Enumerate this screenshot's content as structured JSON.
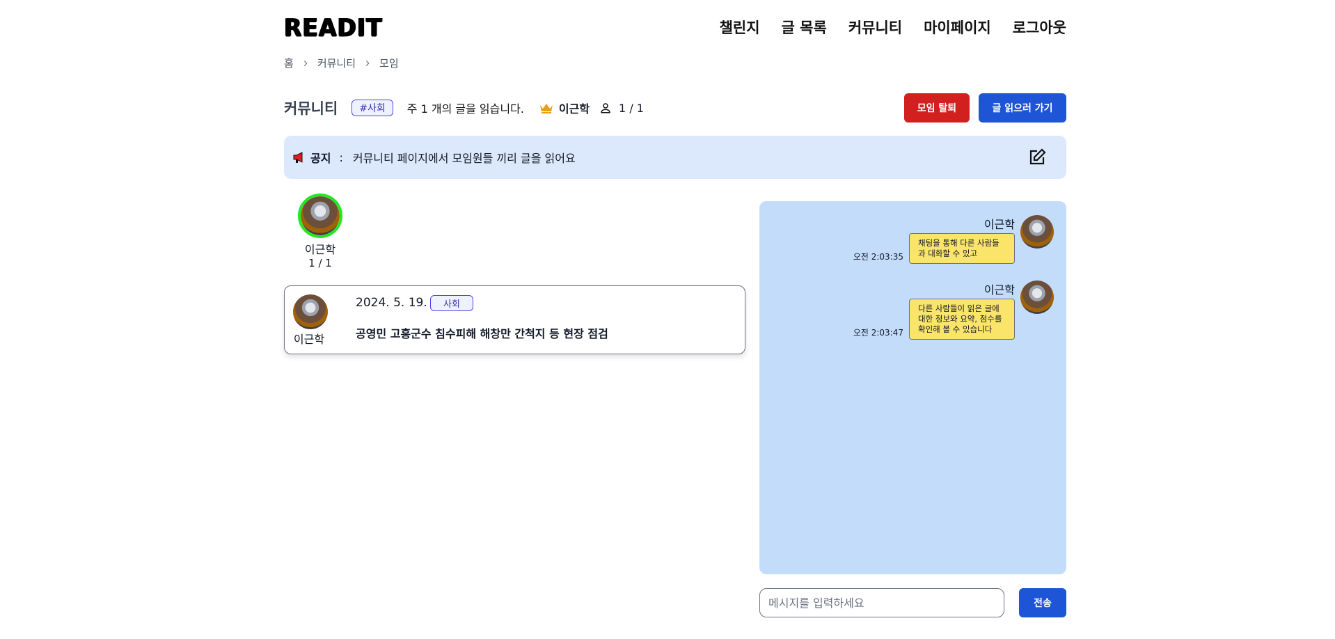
{
  "header": {
    "logo": "READIT",
    "nav": [
      "챌린지",
      "글 목록",
      "커뮤니티",
      "마이페이지",
      "로그아웃"
    ]
  },
  "breadcrumb": [
    "홈",
    "커뮤니티",
    "모임"
  ],
  "community": {
    "title": "커뮤니티",
    "tag": "#사회",
    "weekly_goal": "주 1 개의 글을 읽습니다.",
    "leader_name": "이근학",
    "member_count": "1 / 1",
    "leave_button": "모임 탈퇴",
    "read_button": "글 읽으러 가기"
  },
  "notice": {
    "label": "공지",
    "colon": ":",
    "text": "커뮤니티 페이지에서 모임원들 끼리 글을 읽어요"
  },
  "members": [
    {
      "name": "이근학",
      "progress": "1 / 1"
    }
  ],
  "posts": [
    {
      "author": "이근학",
      "date": "2024. 5. 19.",
      "category": "사회",
      "title": "공영민 고흥군수 침수피해 해창만 간척지 등 현장 점검"
    }
  ],
  "chat": {
    "messages": [
      {
        "name": "이근학",
        "time": "오전 2:03:35",
        "text": "채팅을 통해 다른 사람들과 대화할 수 있고"
      },
      {
        "name": "이근학",
        "time": "오전 2:03:47",
        "text": "다른 사람들이 읽은 글에 대한 정보와 요약, 점수를 확인해 볼 수 있습니다"
      }
    ],
    "input_placeholder": "메시지를 입력하세요",
    "send_label": "전송"
  },
  "colors": {
    "leave_button": "#d21f1f",
    "primary_button": "#1e55d6",
    "notice_bg": "#dce9fd",
    "chat_bg": "#c3dcfa",
    "bubble_bg": "#fbe46a",
    "avatar_ring": "#22e822"
  },
  "icons": {
    "crown": "crown-icon",
    "person": "person-icon",
    "megaphone": "megaphone-icon",
    "edit": "edit-icon",
    "chevron": "chevron-right-icon"
  }
}
